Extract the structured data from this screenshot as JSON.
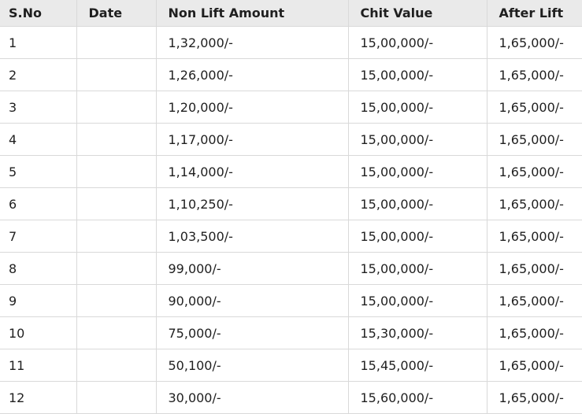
{
  "table": {
    "headers": [
      "S.No",
      "Date",
      "Non Lift Amount",
      "Chit Value",
      "After Lift"
    ],
    "rows": [
      [
        "1",
        "",
        "1,32,000/-",
        "15,00,000/-",
        "1,65,000/-"
      ],
      [
        "2",
        "",
        "1,26,000/-",
        "15,00,000/-",
        "1,65,000/-"
      ],
      [
        "3",
        "",
        "1,20,000/-",
        "15,00,000/-",
        "1,65,000/-"
      ],
      [
        "4",
        "",
        "1,17,000/-",
        "15,00,000/-",
        "1,65,000/-"
      ],
      [
        "5",
        "",
        "1,14,000/-",
        "15,00,000/-",
        "1,65,000/-"
      ],
      [
        "6",
        "",
        "1,10,250/-",
        "15,00,000/-",
        "1,65,000/-"
      ],
      [
        "7",
        "",
        "1,03,500/-",
        "15,00,000/-",
        "1,65,000/-"
      ],
      [
        "8",
        "",
        "99,000/-",
        "15,00,000/-",
        "1,65,000/-"
      ],
      [
        "9",
        "",
        "90,000/-",
        "15,00,000/-",
        "1,65,000/-"
      ],
      [
        "10",
        "",
        "75,000/-",
        "15,30,000/-",
        "1,65,000/-"
      ],
      [
        "11",
        "",
        "50,100/-",
        "15,45,000/-",
        "1,65,000/-"
      ],
      [
        "12",
        "",
        "30,000/-",
        "15,60,000/-",
        "1,65,000/-"
      ]
    ]
  }
}
